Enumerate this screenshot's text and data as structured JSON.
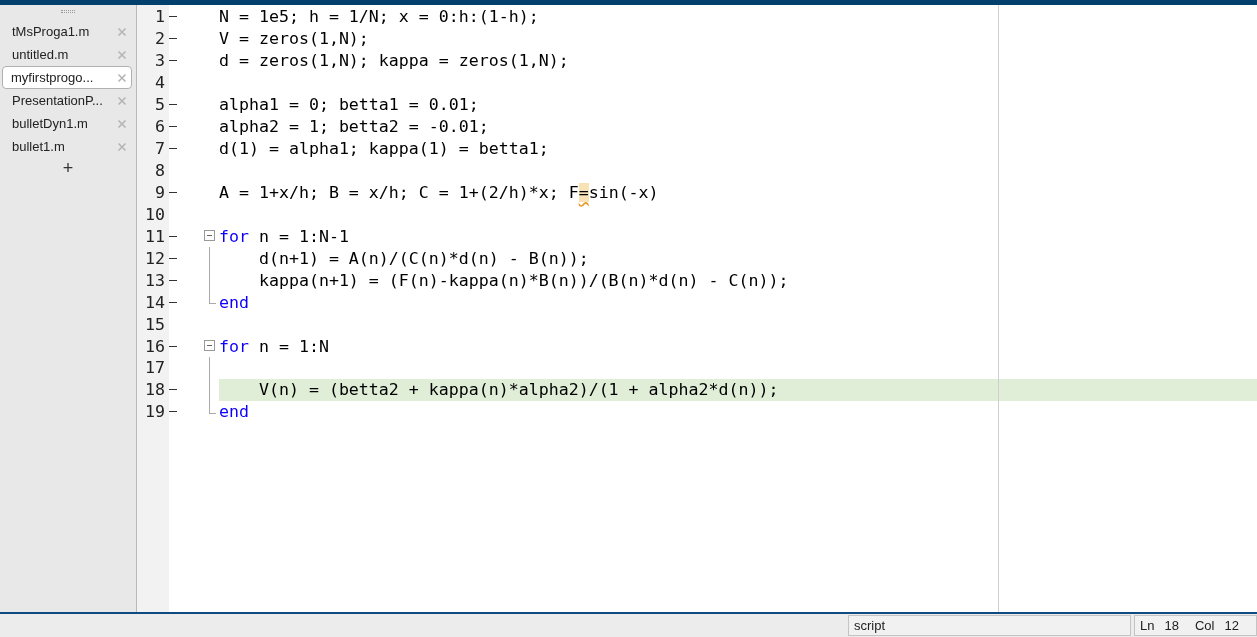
{
  "file_tabs": [
    {
      "label": "tMsProga1.m",
      "selected": false
    },
    {
      "label": "untitled.m",
      "selected": false
    },
    {
      "label": "myfirstprogo...",
      "selected": true
    },
    {
      "label": "PresentationP...",
      "selected": false
    },
    {
      "label": "bulletDyn1.m",
      "selected": false
    },
    {
      "label": "bullet1.m",
      "selected": false
    }
  ],
  "new_tab": "+",
  "editor": {
    "lines": [
      {
        "number": "1",
        "kind": "line",
        "executable": true,
        "current": false,
        "tokens": [
          {
            "kind": "plain",
            "text": "N = 1e5; h = 1/N; x = 0:h:(1-h);"
          }
        ]
      },
      {
        "number": "2",
        "kind": "line",
        "executable": true,
        "current": false,
        "tokens": [
          {
            "kind": "plain",
            "text": "V = zeros(1,N);"
          }
        ]
      },
      {
        "number": "3",
        "kind": "line",
        "executable": true,
        "current": false,
        "tokens": [
          {
            "kind": "plain",
            "text": "d = zeros(1,N); kappa = zeros(1,N);"
          }
        ]
      },
      {
        "number": "4",
        "kind": "line",
        "executable": false,
        "current": false
      },
      {
        "number": "5",
        "kind": "line",
        "executable": true,
        "current": false,
        "tokens": [
          {
            "kind": "plain",
            "text": "alpha1 = 0; betta1 = 0.01;"
          }
        ]
      },
      {
        "number": "6",
        "kind": "line",
        "executable": true,
        "current": false,
        "tokens": [
          {
            "kind": "plain",
            "text": "alpha2 = 1; betta2 = -0.01;"
          }
        ]
      },
      {
        "number": "7",
        "kind": "line",
        "executable": true,
        "current": false,
        "tokens": [
          {
            "kind": "plain",
            "text": "d(1) = alpha1; kappa(1) = betta1;"
          }
        ]
      },
      {
        "number": "8",
        "kind": "line",
        "executable": false,
        "current": false
      },
      {
        "number": "9",
        "kind": "line",
        "executable": true,
        "current": false,
        "tokens": [
          {
            "kind": "plain",
            "text": "A = 1+x/h; B = x/h; C = 1+(2/h)*x; F"
          },
          {
            "kind": "warning",
            "text": "="
          },
          {
            "kind": "plain",
            "text": "sin(-x)"
          }
        ]
      },
      {
        "number": "10",
        "kind": "line",
        "executable": false,
        "current": false
      },
      {
        "number": "11",
        "kind": "fold_start",
        "executable": true,
        "current": false,
        "tokens": [
          {
            "kind": "keyword",
            "text": "for"
          },
          {
            "kind": "plain",
            "text": " n = 1:N-1"
          }
        ]
      },
      {
        "number": "12",
        "kind": "fold_body",
        "executable": true,
        "current": false,
        "tokens": [
          {
            "kind": "plain",
            "text": "    d(n+1) = A(n)/(C(n)*d(n) - B(n));"
          }
        ]
      },
      {
        "number": "13",
        "kind": "fold_body",
        "executable": true,
        "current": false,
        "tokens": [
          {
            "kind": "plain",
            "text": "    kappa(n+1) = (F(n)-kappa(n)*B(n))/(B(n)*d(n) - C(n));"
          }
        ]
      },
      {
        "number": "14",
        "kind": "fold_end",
        "executable": true,
        "current": false,
        "tokens": [
          {
            "kind": "keyword",
            "text": "end"
          }
        ]
      },
      {
        "number": "15",
        "kind": "line",
        "executable": false,
        "current": false
      },
      {
        "number": "16",
        "kind": "fold_start",
        "executable": true,
        "current": false,
        "tokens": [
          {
            "kind": "keyword",
            "text": "for"
          },
          {
            "kind": "plain",
            "text": " n = 1:N"
          }
        ]
      },
      {
        "number": "17",
        "kind": "fold_body",
        "executable": false,
        "current": false
      },
      {
        "number": "18",
        "kind": "fold_body",
        "executable": true,
        "current": true,
        "tokens": [
          {
            "kind": "plain",
            "text": "    V(n) = (betta2 + kappa(n)*alpha2)/(1 + alpha2*d(n));"
          }
        ]
      },
      {
        "number": "19",
        "kind": "fold_end",
        "executable": true,
        "current": false,
        "tokens": [
          {
            "kind": "keyword",
            "text": "end"
          }
        ]
      }
    ]
  },
  "status_bar": {
    "file_type": "script",
    "line_label": "Ln",
    "line": "18",
    "column_label": "Col",
    "column": "12"
  }
}
